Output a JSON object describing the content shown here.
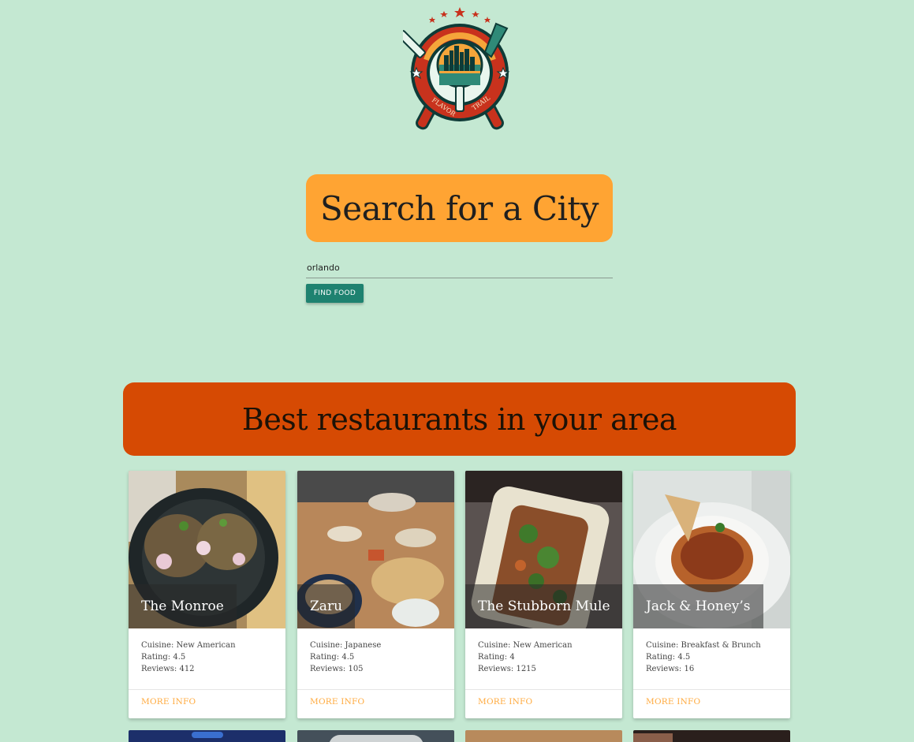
{
  "logo": {
    "text_top": "FLAVOR",
    "text_bottom": "TRAIL",
    "colors": {
      "ring": "#c8321d",
      "accent": "#f5a53a",
      "dark": "#0e3b37",
      "mint": "#e9f6ee"
    }
  },
  "search": {
    "heading": "Search for a City",
    "input_value": "orlando",
    "button_label": "FIND FOOD"
  },
  "section": {
    "title": "Best restaurants in your area"
  },
  "restaurants": [
    {
      "name": "The Monroe",
      "cuisine": "Cuisine: New American",
      "rating": "Rating: 4.5",
      "reviews": "Reviews: 412",
      "link": "MORE INFO"
    },
    {
      "name": "Zaru",
      "cuisine": "Cuisine: Japanese",
      "rating": "Rating: 4.5",
      "reviews": "Reviews: 105",
      "link": "MORE INFO"
    },
    {
      "name": "The Stubborn Mule",
      "cuisine": "Cuisine: New American",
      "rating": "Rating: 4",
      "reviews": "Reviews: 1215",
      "link": "MORE INFO"
    },
    {
      "name": "Jack & Honey’s",
      "cuisine": "Cuisine: Breakfast & Brunch",
      "rating": "Rating: 4.5",
      "reviews": "Reviews: 16",
      "link": "MORE INFO"
    }
  ],
  "colors": {
    "background": "#c4e8d2",
    "search_heading_bg": "#ffa433",
    "button_bg": "#1e8270",
    "banner_bg": "#d64a03",
    "link": "#ffab40"
  }
}
